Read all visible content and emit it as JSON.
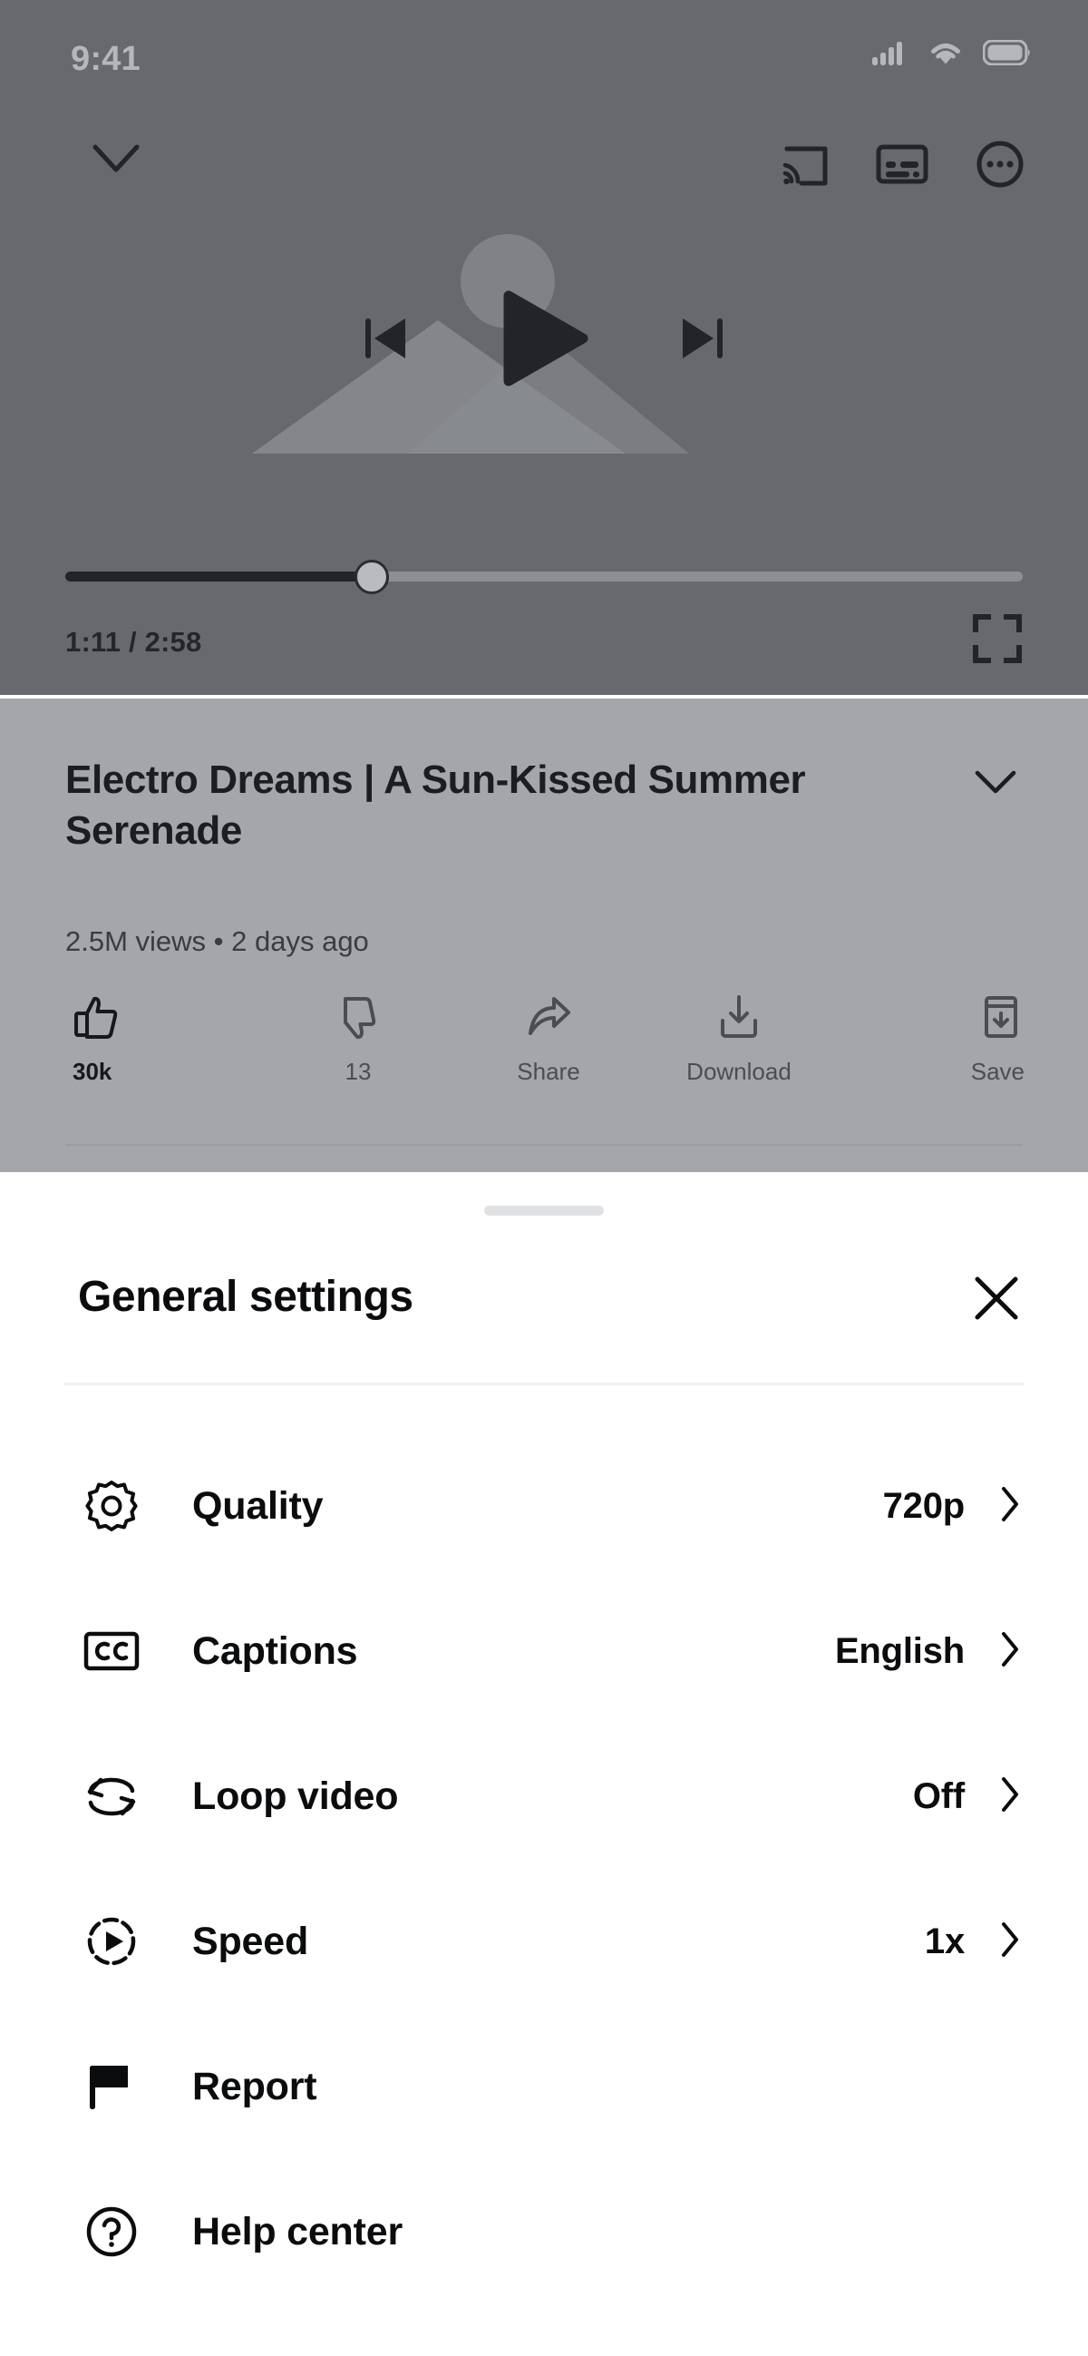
{
  "status_bar": {
    "time": "9:41",
    "icons": [
      "cellular-signal-icon",
      "wifi-icon",
      "battery-icon"
    ]
  },
  "player": {
    "collapse_icon": "chevron-down-icon",
    "top_actions": [
      {
        "name": "cast-icon",
        "label": "Cast"
      },
      {
        "name": "captions-icon",
        "label": "Captions"
      },
      {
        "name": "more-options-icon",
        "label": "More options"
      }
    ],
    "playback": [
      {
        "name": "previous-icon",
        "label": "Previous"
      },
      {
        "name": "play-icon",
        "label": "Play"
      },
      {
        "name": "next-icon",
        "label": "Next"
      }
    ],
    "progress_percent": 32,
    "time_label": "1:11 / 2:58",
    "current_time": "1:11",
    "duration": "2:58",
    "fullscreen_icon": "fullscreen-icon",
    "thumbnail_placeholder": "mountain-sun-image-placeholder",
    "overlay_color": "#67696f"
  },
  "video_info": {
    "title": "Electro Dreams | A Sun-Kissed Summer Serenade",
    "meta": "2.5M views • 2 days ago",
    "views": "2.5M views",
    "published": "2 days ago",
    "expand_icon": "chevron-down-icon",
    "overlay_color": "#a4a6a9",
    "actions": [
      {
        "icon": "thumbs-up-icon",
        "label": "30k",
        "emphasis": true
      },
      {
        "icon": "thumbs-down-icon",
        "label": "13",
        "emphasis": false
      },
      {
        "icon": "share-icon",
        "label": "Share",
        "emphasis": false
      },
      {
        "icon": "download-icon",
        "label": "Download",
        "emphasis": false
      },
      {
        "icon": "save-icon",
        "label": "Save",
        "emphasis": false
      }
    ]
  },
  "sheet": {
    "handle": "drag-handle",
    "title": "General settings",
    "close_icon": "close-icon",
    "items": [
      {
        "icon": "gear-icon",
        "label": "Quality",
        "value": "720p",
        "chevron": true
      },
      {
        "icon": "closed-captions-icon",
        "label": "Captions",
        "value": "English",
        "chevron": true
      },
      {
        "icon": "loop-icon",
        "label": "Loop video",
        "value": "Off",
        "chevron": true
      },
      {
        "icon": "speed-icon",
        "label": "Speed",
        "value": "1x",
        "chevron": true
      },
      {
        "icon": "flag-icon",
        "label": "Report",
        "value": "",
        "chevron": false
      },
      {
        "icon": "help-icon",
        "label": "Help center",
        "value": "",
        "chevron": false
      }
    ]
  }
}
